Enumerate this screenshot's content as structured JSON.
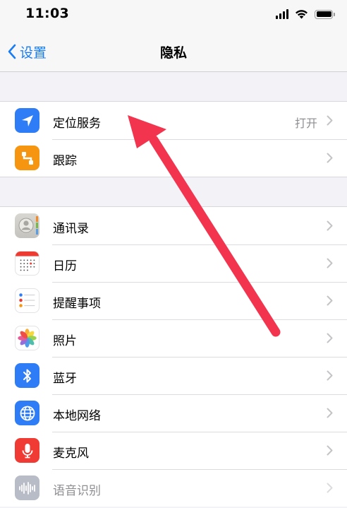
{
  "status_bar": {
    "time": "11:03"
  },
  "nav": {
    "back_label": "设置",
    "title": "隐私"
  },
  "group1": [
    {
      "label": "定位服务",
      "value": "打开",
      "icon": "location-arrow-icon",
      "icon_bg": "#2f7df6"
    },
    {
      "label": "跟踪",
      "value": "",
      "icon": "tracking-icon",
      "icon_bg": "#f6950f"
    }
  ],
  "group2": [
    {
      "label": "通讯录",
      "icon": "contacts-icon"
    },
    {
      "label": "日历",
      "icon": "calendar-icon"
    },
    {
      "label": "提醒事项",
      "icon": "reminders-icon"
    },
    {
      "label": "照片",
      "icon": "photos-icon"
    },
    {
      "label": "蓝牙",
      "icon": "bluetooth-icon",
      "icon_bg": "#2f7df6"
    },
    {
      "label": "本地网络",
      "icon": "globe-icon",
      "icon_bg": "#2f7df6"
    },
    {
      "label": "麦克风",
      "icon": "microphone-icon",
      "icon_bg": "#ef3b33"
    },
    {
      "label": "语音识别",
      "icon": "speech-recognition-icon",
      "icon_bg": "#b8bcc6"
    }
  ],
  "colors": {
    "accent": "#1a7cf5",
    "annotation_arrow": "#f2344f"
  }
}
